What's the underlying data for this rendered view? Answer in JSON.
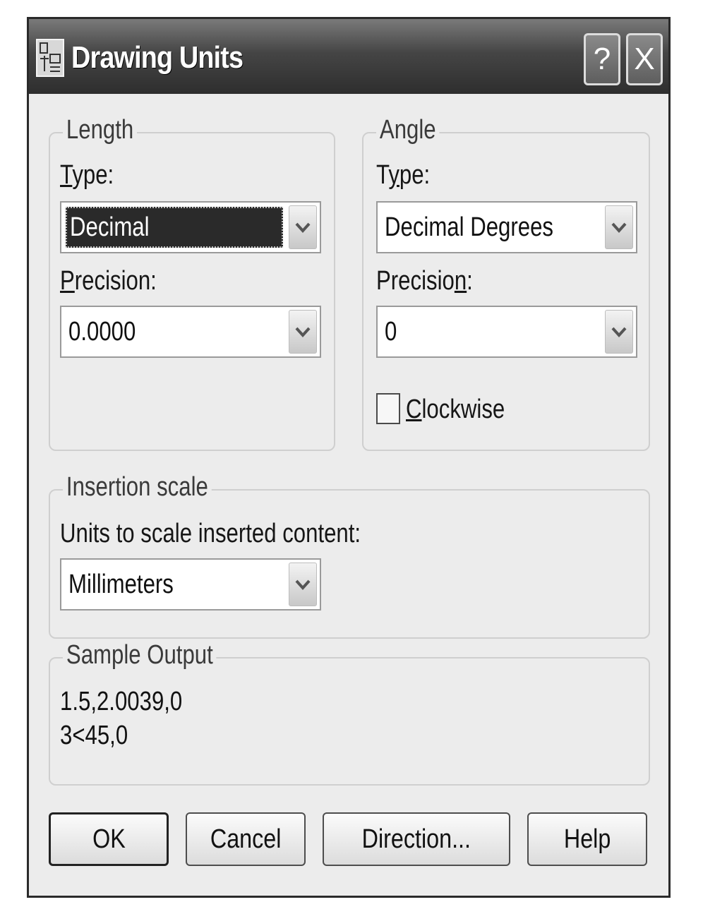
{
  "window": {
    "title": "Drawing Units",
    "help_symbol": "?",
    "close_symbol": "X"
  },
  "length": {
    "group_label": "Length",
    "type_label": "Type:",
    "type_value": "Decimal",
    "precision_label": "Precision:",
    "precision_value": "0.0000"
  },
  "angle": {
    "group_label": "Angle",
    "type_label": "Type:",
    "type_value": "Decimal Degrees",
    "precision_label": "Precision:",
    "precision_value": "0",
    "clockwise_label": "Clockwise",
    "clockwise_checked": false
  },
  "insertion_scale": {
    "group_label": "Insertion scale",
    "units_label": "Units to scale inserted content:",
    "units_value": "Millimeters"
  },
  "sample_output": {
    "group_label": "Sample Output",
    "line1": "1.5,2.0039,0",
    "line2": "3<45,0"
  },
  "buttons": {
    "ok": "OK",
    "cancel": "Cancel",
    "direction": "Direction...",
    "help": "Help"
  },
  "icons": {
    "app": "drawing-units-icon",
    "dropdown": "chevron-down-icon"
  }
}
